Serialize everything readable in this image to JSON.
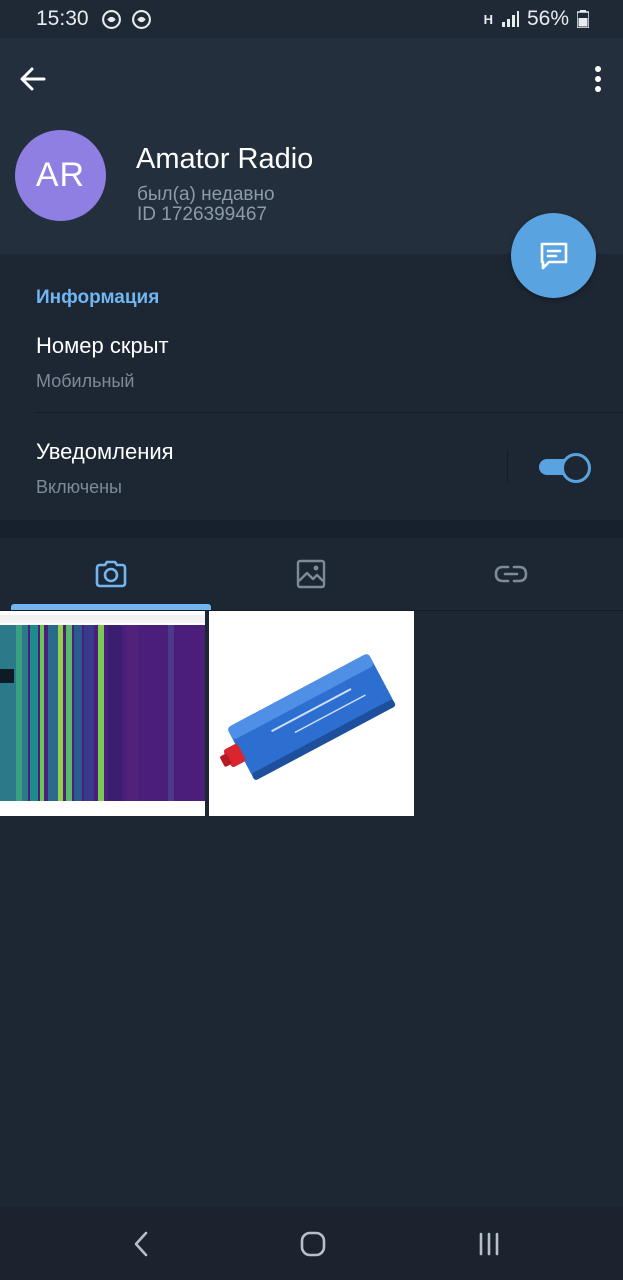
{
  "status_bar": {
    "time": "15:30",
    "network": "H",
    "battery": "56%"
  },
  "header": {
    "back_icon": "arrow-left-icon",
    "menu_icon": "more-vertical-icon"
  },
  "profile": {
    "avatar_initials": "AR",
    "avatar_color": "#8f7fe3",
    "name": "Amator Radio",
    "status": "был(а) недавно",
    "id_text": "ID 1726399467"
  },
  "fab": {
    "icon": "message-icon",
    "color": "#5aa3e1"
  },
  "info": {
    "section_title": "Информация",
    "phone_value": "Номер скрыт",
    "phone_label": "Мобильный",
    "notifications_value": "Уведомления",
    "notifications_label": "Включены",
    "notifications_on": true
  },
  "tabs": [
    {
      "icon": "camera-icon",
      "active": true
    },
    {
      "icon": "image-icon",
      "active": false
    },
    {
      "icon": "link-icon",
      "active": false
    }
  ],
  "media": [
    {
      "icon": "spectrum-waterfall-image"
    },
    {
      "icon": "sdr-device-image"
    }
  ],
  "colors": {
    "background": "#1d2733",
    "header": "#242f3d",
    "accent": "#71b6f1"
  }
}
